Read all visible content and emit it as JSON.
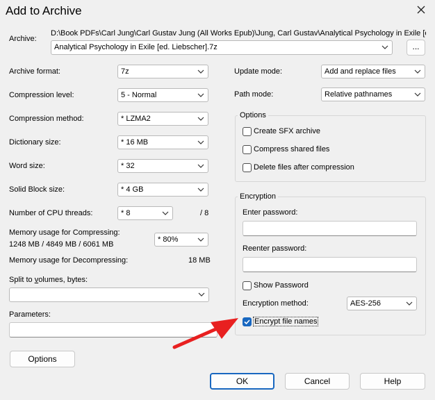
{
  "window": {
    "title": "Add to Archive"
  },
  "archive": {
    "label": "Archive:",
    "path": "D:\\Book PDFs\\Carl Jung\\Carl Gustav Jung (All Works Epub)\\Jung, Carl Gustav\\Analytical Psychology in Exile [ed.",
    "name": "Analytical Psychology in Exile [ed. Liebscher].7z",
    "browse_label": "..."
  },
  "left": {
    "format_label": "Archive format:",
    "format_value": "7z",
    "level_label": "Compression level:",
    "level_value": "5 - Normal",
    "method_label": "Compression method:",
    "method_value": "*  LZMA2",
    "dict_label": "Dictionary size:",
    "dict_value": "*  16 MB",
    "word_label": "Word size:",
    "word_value": "*  32",
    "solid_label": "Solid Block size:",
    "solid_value": "*  4 GB",
    "threads_label": "Number of CPU threads:",
    "threads_value": "*  8",
    "threads_max": "/ 8",
    "mem_comp_label": "Memory usage for Compressing:",
    "mem_comp_value": "1248 MB / 4849 MB / 6061 MB",
    "mem_comp_select": "* 80%",
    "mem_decomp_label": "Memory usage for Decompressing:",
    "mem_decomp_value": "18 MB",
    "split_label": "Split to volumes, bytes:",
    "split_value": "",
    "params_label": "Parameters:",
    "params_value": "",
    "options_button": "Options"
  },
  "right": {
    "update_label": "Update mode:",
    "update_value": "Add and replace files",
    "path_label": "Path mode:",
    "path_value": "Relative pathnames",
    "options_group": "Options",
    "sfx_label": "Create SFX archive",
    "shared_label": "Compress shared files",
    "delete_label": "Delete files after compression",
    "encryption_group": "Encryption",
    "password_label": "Enter password:",
    "reenter_label": "Reenter password:",
    "show_password_label": "Show Password",
    "enc_method_label": "Encryption method:",
    "enc_method_value": "AES-256",
    "encrypt_names_label": "Encrypt file names",
    "encrypt_names_checked": true
  },
  "buttons": {
    "ok": "OK",
    "cancel": "Cancel",
    "help": "Help"
  },
  "colors": {
    "accent": "#1867c0",
    "annotation_arrow": "#e82020"
  }
}
